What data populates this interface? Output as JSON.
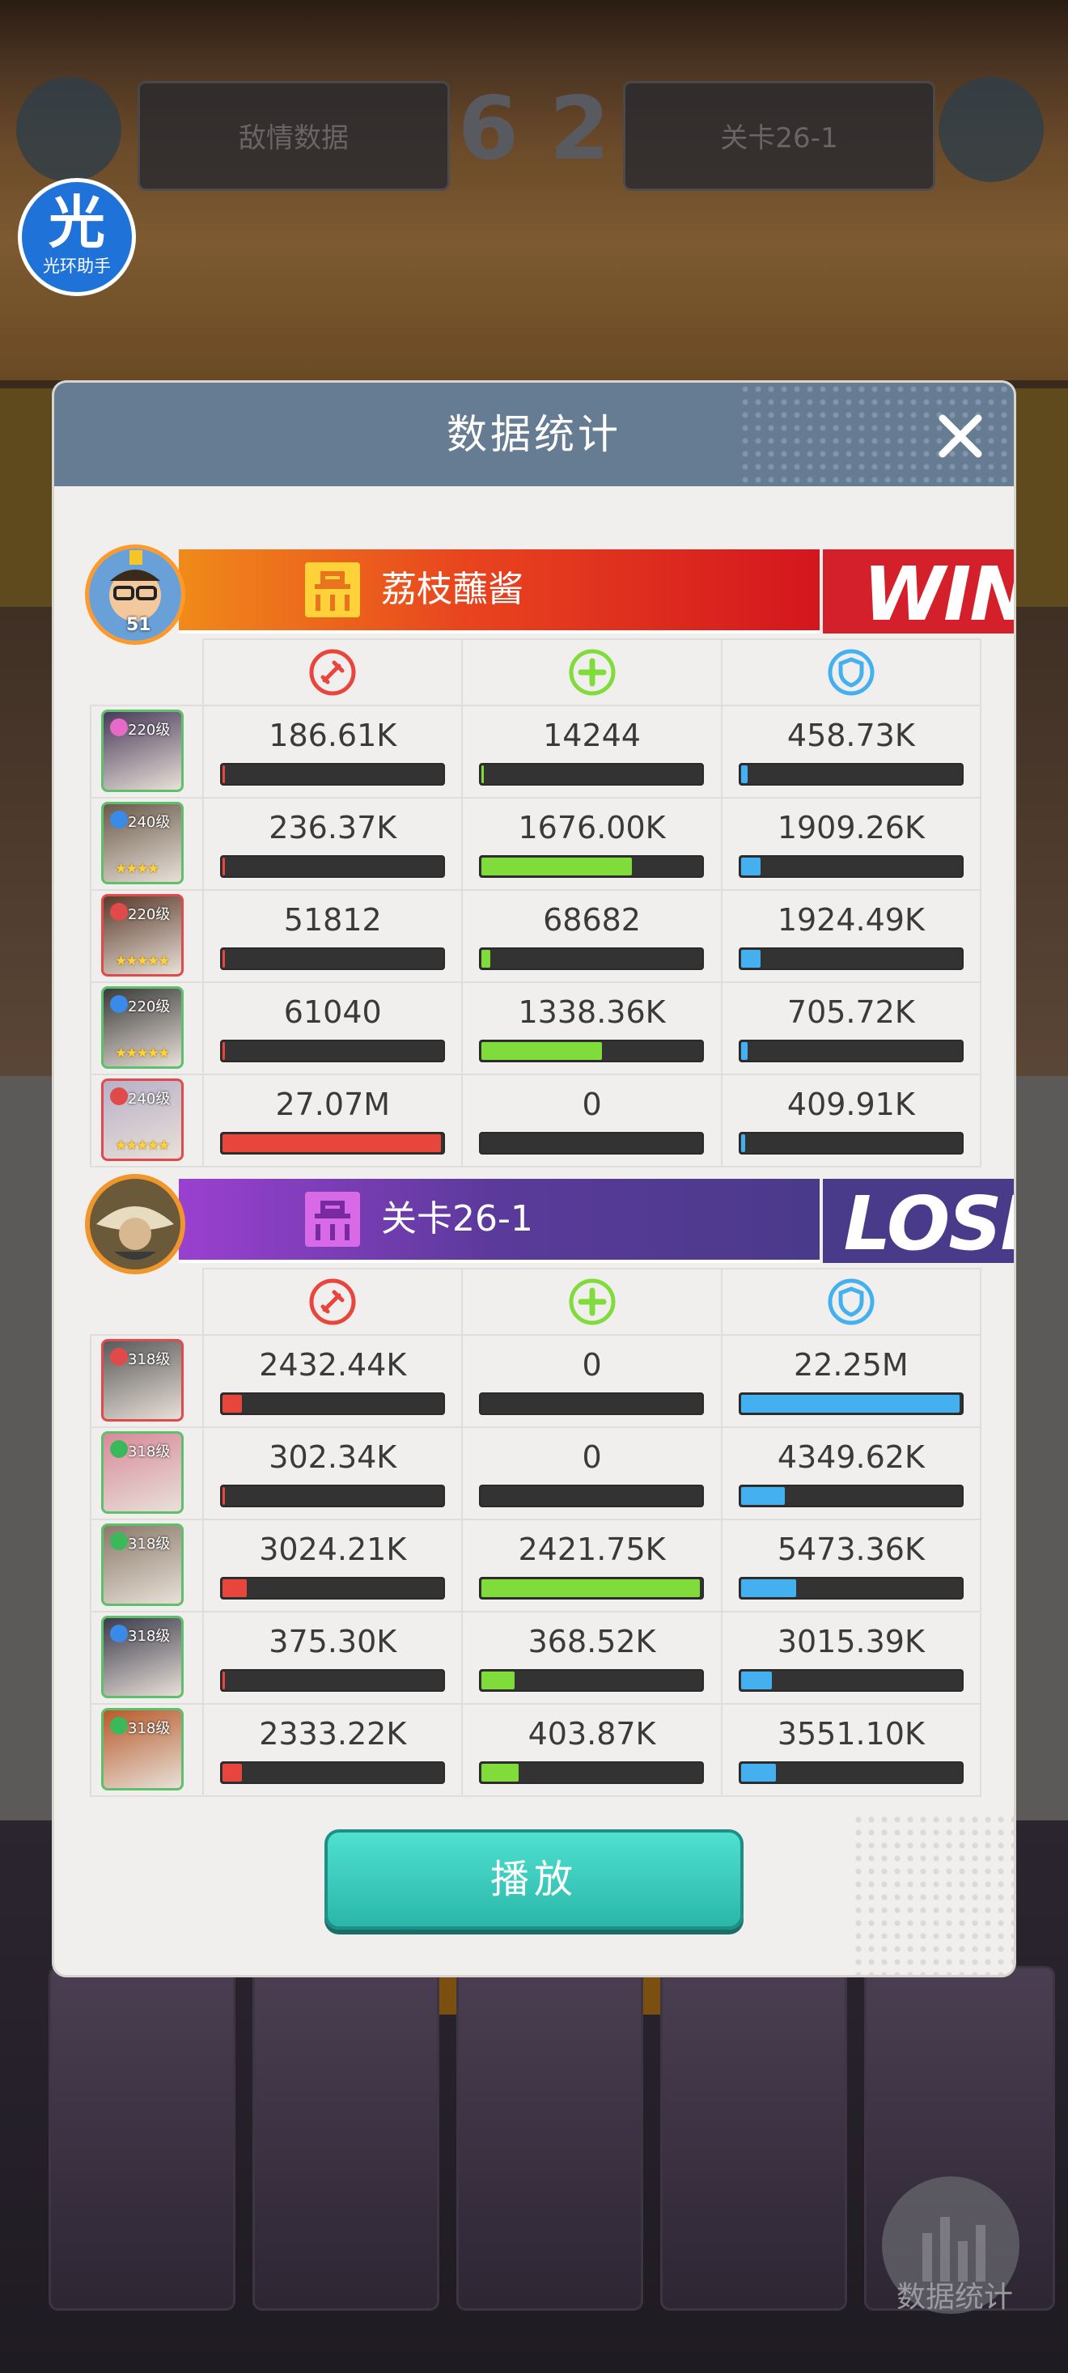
{
  "background": {
    "score": "6 2",
    "left_panel_label": "敌情数据",
    "right_panel_label": "关卡26-1",
    "stats_button_label": "数据统计"
  },
  "assistant": {
    "glyph": "光",
    "label": "光环助手"
  },
  "modal": {
    "title": "数据统计",
    "play_label": "播放"
  },
  "colors": {
    "damage": "#e8453c",
    "heal": "#7fdc3a",
    "tank": "#45b0f0",
    "win_red": "#d4202a",
    "lose_purple": "#4a3a8a",
    "header": "#667c93",
    "button": "#36c8bb"
  },
  "icons": {
    "damage": "sword-icon",
    "heal": "plus-icon",
    "tank": "shield-icon",
    "close": "close-icon"
  },
  "teams": [
    {
      "name": "荔枝蘸酱",
      "result": "WIN",
      "leader_level": "51",
      "heroes": [
        {
          "level": "220级",
          "stars": 0,
          "faction": "pink",
          "damage": "186.61K",
          "damage_pct": 1,
          "heal": "14244",
          "heal_pct": 1,
          "tank": "458.73K",
          "tank_pct": 3
        },
        {
          "level": "240级",
          "stars": 4,
          "faction": "blue",
          "damage": "236.37K",
          "damage_pct": 1,
          "heal": "1676.00K",
          "heal_pct": 69,
          "tank": "1909.26K",
          "tank_pct": 9
        },
        {
          "level": "220级",
          "stars": 5,
          "faction": "red",
          "damage": "51812",
          "damage_pct": 0.5,
          "heal": "68682",
          "heal_pct": 4,
          "tank": "1924.49K",
          "tank_pct": 9
        },
        {
          "level": "220级",
          "stars": 5,
          "faction": "blue",
          "damage": "61040",
          "damage_pct": 0.5,
          "heal": "1338.36K",
          "heal_pct": 55,
          "tank": "705.72K",
          "tank_pct": 3
        },
        {
          "level": "240级",
          "stars": 5,
          "faction": "red",
          "damage": "27.07M",
          "damage_pct": 100,
          "heal": "0",
          "heal_pct": 0,
          "tank": "409.91K",
          "tank_pct": 2
        }
      ]
    },
    {
      "name": "关卡26-1",
      "result": "LOSE",
      "heroes": [
        {
          "level": "318级",
          "stars": 0,
          "faction": "red",
          "damage": "2432.44K",
          "damage_pct": 9,
          "heal": "0",
          "heal_pct": 0,
          "tank": "22.25M",
          "tank_pct": 100
        },
        {
          "level": "318级",
          "stars": 0,
          "faction": "green",
          "damage": "302.34K",
          "damage_pct": 1,
          "heal": "0",
          "heal_pct": 0,
          "tank": "4349.62K",
          "tank_pct": 20
        },
        {
          "level": "318级",
          "stars": 0,
          "faction": "green",
          "damage": "3024.21K",
          "damage_pct": 11,
          "heal": "2421.75K",
          "heal_pct": 100,
          "tank": "5473.36K",
          "tank_pct": 25
        },
        {
          "level": "318级",
          "stars": 0,
          "faction": "blue",
          "damage": "375.30K",
          "damage_pct": 1,
          "heal": "368.52K",
          "heal_pct": 15,
          "tank": "3015.39K",
          "tank_pct": 14
        },
        {
          "level": "318级",
          "stars": 0,
          "faction": "green",
          "damage": "2333.22K",
          "damage_pct": 9,
          "heal": "403.87K",
          "heal_pct": 17,
          "tank": "3551.10K",
          "tank_pct": 16
        }
      ]
    }
  ]
}
